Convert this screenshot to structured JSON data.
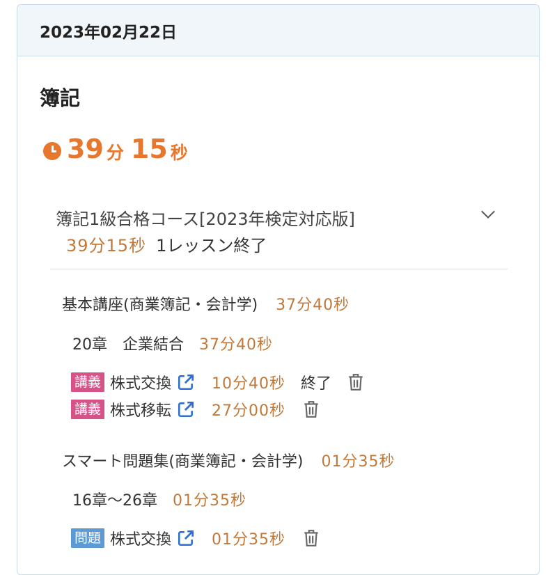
{
  "header": {
    "date": "2023年02月22日"
  },
  "subject": {
    "name": "簿記",
    "total_time": {
      "min": "39",
      "min_unit": "分",
      "sec": "15",
      "sec_unit": "秒"
    }
  },
  "course": {
    "title": "簿記1級合格コース[2023年検定対応版]",
    "time": "39分15秒",
    "status": "1レッスン終了"
  },
  "sections": [
    {
      "title": "基本講座(商業簿記・会計学)",
      "time": "37分40秒",
      "chapter": {
        "title": "20章　企業結合",
        "time": "37分40秒"
      },
      "items": [
        {
          "badge": "講義",
          "title": "株式交換",
          "time": "10分40秒",
          "status": "終了"
        },
        {
          "badge": "講義",
          "title": "株式移転",
          "time": "27分00秒",
          "status": ""
        }
      ]
    },
    {
      "title": "スマート問題集(商業簿記・会計学)",
      "time": "01分35秒",
      "chapter": {
        "title": "16章〜26章",
        "time": "01分35秒"
      },
      "items": [
        {
          "badge": "問題",
          "title": "株式交換",
          "time": "01分35秒",
          "status": ""
        }
      ]
    }
  ],
  "colors": {
    "accent_orange": "#e8772e",
    "time_orange": "#c0793a",
    "lecture_badge": "#d65287",
    "problem_badge": "#5b9ad5",
    "link_blue": "#2f6fd1",
    "header_bg": "#f1f6fa"
  },
  "icons": {
    "clock": "clock-icon",
    "chevron": "chevron-down-icon",
    "external": "external-link-icon",
    "trash": "trash-icon"
  }
}
